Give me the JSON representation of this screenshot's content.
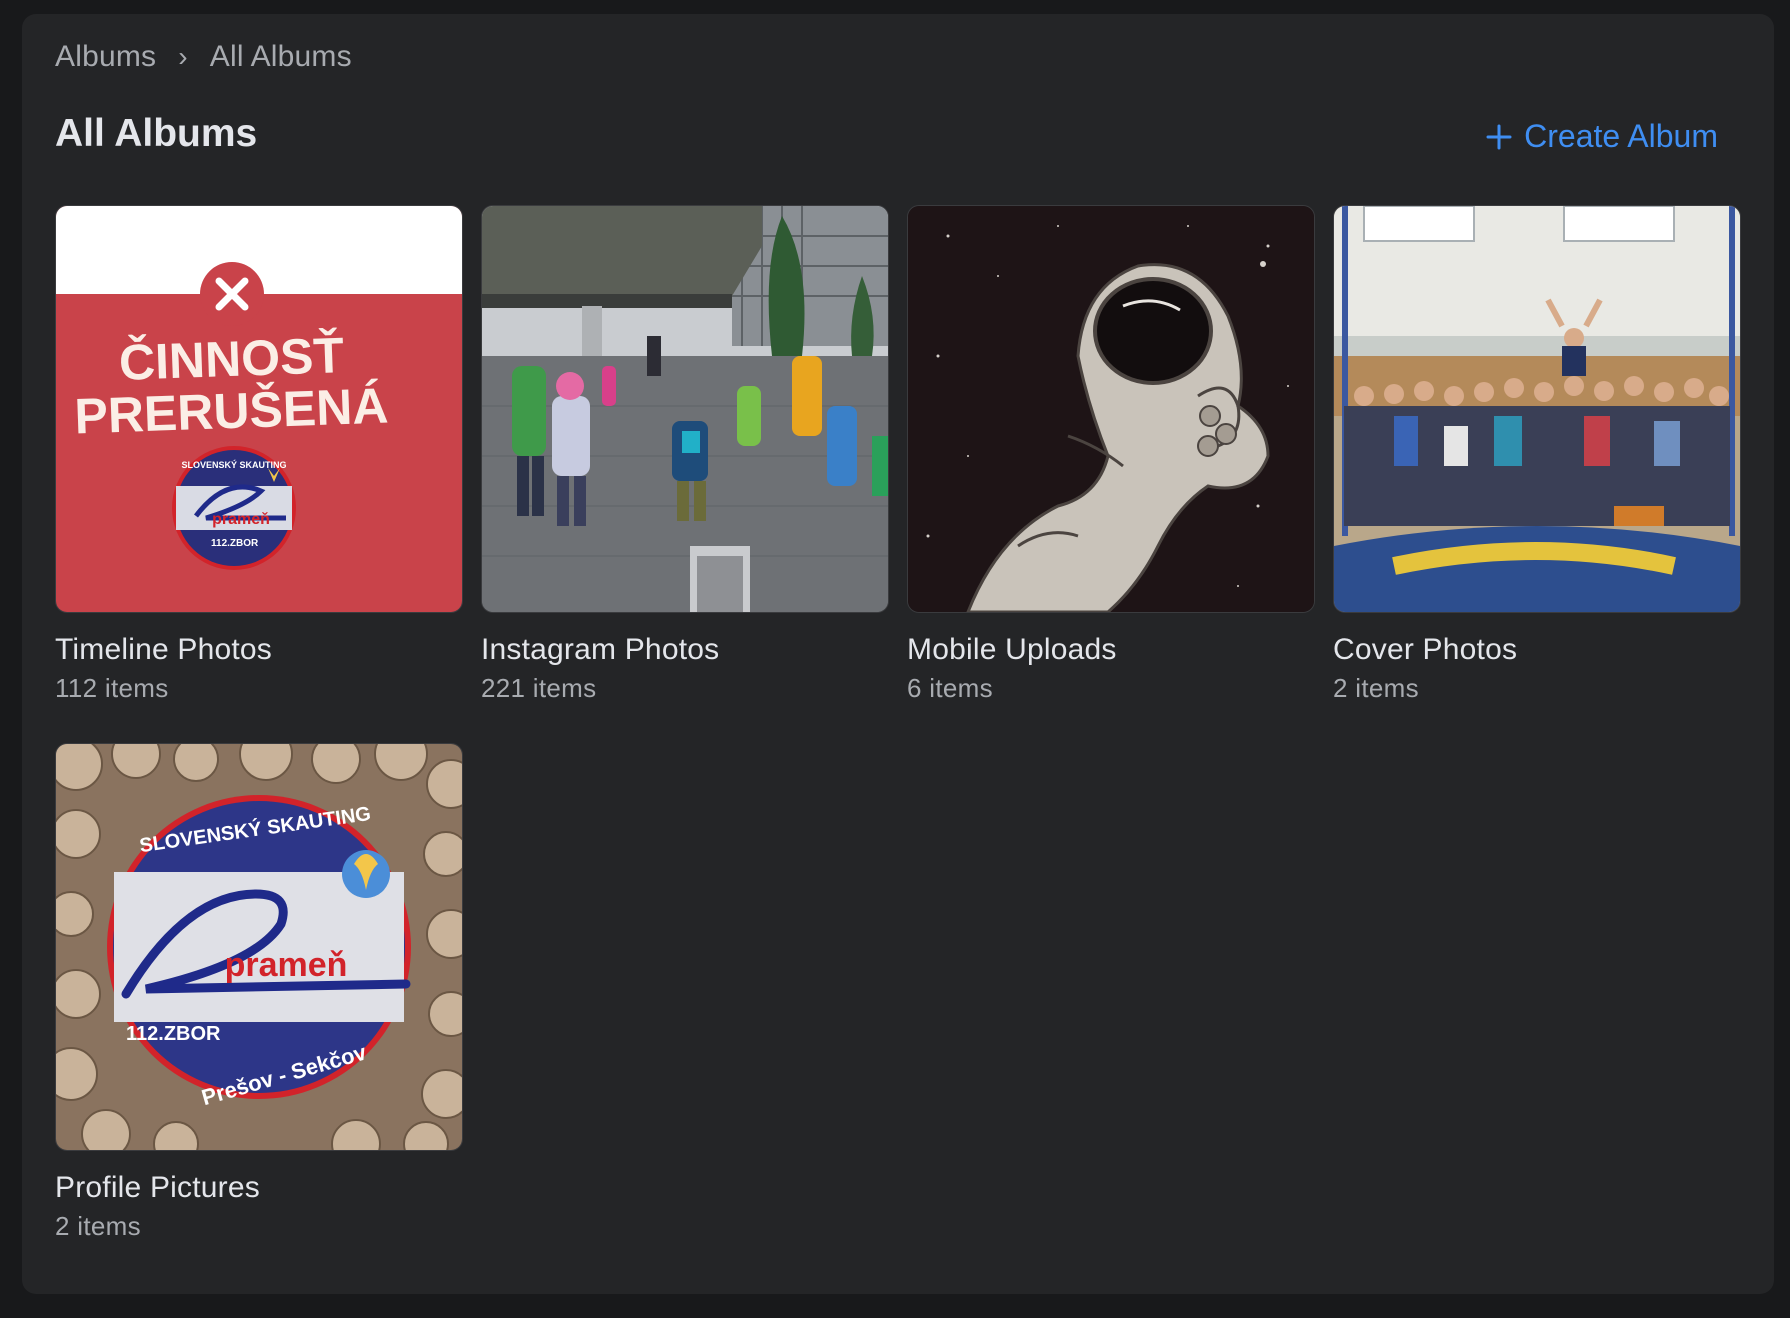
{
  "breadcrumb": {
    "root": "Albums",
    "current": "All Albums"
  },
  "page": {
    "title": "All Albums"
  },
  "toolbar": {
    "create_label": "Create Album",
    "create_icon": "plus-icon"
  },
  "colors": {
    "background": "#18191b",
    "panel": "#242527",
    "accent": "#3f8ef2",
    "text_primary": "#e4e6eb",
    "text_secondary": "#a8abb0"
  },
  "albums": [
    {
      "name": "Timeline Photos",
      "count": "112 items",
      "thumb_text": {
        "line1": "ČINNOSŤ",
        "line2": "PRERUŠENÁ",
        "badge_ring": "SLOVENSKÝ SKAUTING",
        "badge_name": "prameň",
        "badge_unit": "112.ZBOR"
      }
    },
    {
      "name": "Instagram Photos",
      "count": "221 items"
    },
    {
      "name": "Mobile Uploads",
      "count": "6 items"
    },
    {
      "name": "Cover Photos",
      "count": "2 items"
    },
    {
      "name": "Profile Pictures",
      "count": "2 items",
      "thumb_text": {
        "badge_ring": "SLOVENSKÝ SKAUTING",
        "badge_name": "prameň",
        "badge_unit": "112.ZBOR",
        "badge_town": "Prešov - Sekčov"
      }
    }
  ]
}
